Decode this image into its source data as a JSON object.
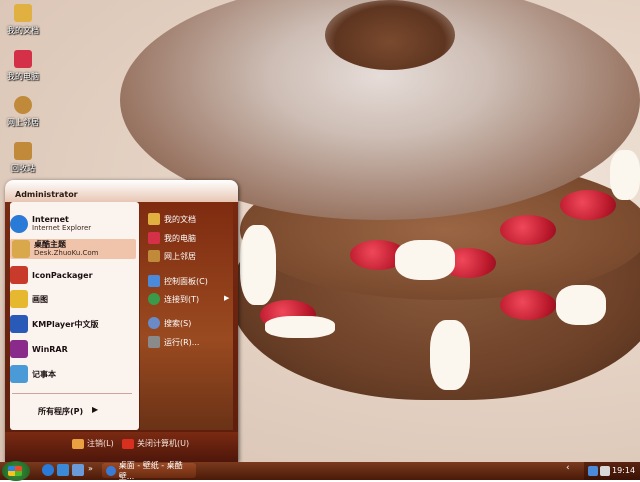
{
  "desktop_icons": [
    {
      "label": "我的文档",
      "icon": "my-documents-icon",
      "color": "#e0b040"
    },
    {
      "label": "我的电脑",
      "icon": "my-computer-icon",
      "color": "#d43048"
    },
    {
      "label": "网上邻居",
      "icon": "network-icon",
      "color": "#c08a3a"
    },
    {
      "label": "回收站",
      "icon": "recycle-bin-icon",
      "color": "#c08a3a"
    }
  ],
  "start_menu": {
    "user": "Administrator",
    "pinned": [
      {
        "title": "Internet",
        "subtitle": "Internet Explorer",
        "icon": "internet-explorer-icon",
        "color": "#2a7ad8"
      },
      {
        "title": "桌酷主题",
        "subtitle": "Desk.ZhuoKu.Com",
        "icon": "zhuoku-theme-icon",
        "color": "#d8a84a"
      }
    ],
    "recent": [
      {
        "title": "IconPackager",
        "icon": "iconpackager-icon",
        "color": "#c83a2a"
      },
      {
        "title": "画图",
        "icon": "paint-icon",
        "color": "#e6b830"
      },
      {
        "title": "KMPlayer中文版",
        "icon": "kmplayer-icon",
        "color": "#2a5ab8"
      },
      {
        "title": "WinRAR",
        "icon": "winrar-icon",
        "color": "#8a2a8a"
      },
      {
        "title": "记事本",
        "icon": "notepad-icon",
        "color": "#4a9ad8"
      }
    ],
    "all_programs": "所有程序(P)",
    "right_items": [
      {
        "title": "我的文档",
        "icon": "my-documents-icon",
        "color": "#e0b040"
      },
      {
        "title": "我的电脑",
        "icon": "my-computer-icon",
        "color": "#d43048"
      },
      {
        "title": "网上邻居",
        "icon": "network-icon",
        "color": "#c08a3a"
      },
      {
        "title": "控制面板(C)",
        "icon": "control-panel-icon",
        "color": "#4a8ad8"
      },
      {
        "title": "连接到(T)",
        "icon": "connect-to-icon",
        "color": "#3a9a4a"
      },
      {
        "title": "搜索(S)",
        "icon": "search-icon",
        "color": "#6a8ac8"
      },
      {
        "title": "运行(R)...",
        "icon": "run-icon",
        "color": "#8a8a8a"
      }
    ],
    "logoff": "注销(L)",
    "shutdown": "关闭计算机(U)"
  },
  "taskbar": {
    "task_label": "桌面 - 壁纸 - 桌酷壁...",
    "clock": "19:14"
  },
  "colors": {
    "accent": "#7a2a12",
    "panel": "#fbf3ee",
    "highlight": "#f0c4ab"
  }
}
